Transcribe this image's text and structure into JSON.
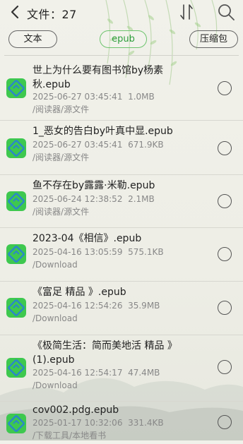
{
  "header": {
    "title": "文件：27"
  },
  "tabs": [
    {
      "label": "文本"
    },
    {
      "label": "epub"
    },
    {
      "label": "压缩包"
    }
  ],
  "files": [
    {
      "name": "世上为什么要有图书馆by杨素秋.epub",
      "date": "2025-06-27 03:45:41",
      "size": "1.0MB",
      "path": "/阅读器/源文件"
    },
    {
      "name": "1_恶女的告白by叶真中显.epub",
      "date": "2025-06-27 03:45:41",
      "size": "671.9KB",
      "path": "/阅读器/源文件"
    },
    {
      "name": "鱼不存在by露露·米勒.epub",
      "date": "2025-06-24 12:38:52",
      "size": "2.1MB",
      "path": "/阅读器/源文件"
    },
    {
      "name": "2023-04《相信》.epub",
      "date": "2025-04-16 13:05:59",
      "size": "575.1KB",
      "path": "/Download"
    },
    {
      "name": "《富足 精品 》.epub",
      "date": "2025-04-16 12:54:26",
      "size": "35.9MB",
      "path": "/Download"
    },
    {
      "name": "《极简生活：简而美地活 精品 》(1).epub",
      "date": "2025-04-16 12:54:17",
      "size": "47.4MB",
      "path": "/Download"
    },
    {
      "name": "cov002.pdg.epub",
      "date": "2025-01-17 10:32:06",
      "size": "331.4KB",
      "path": "/下载工具/本地看书"
    }
  ],
  "colors": {
    "accent": "#2e9e3c",
    "file_icon": "#3ec84f",
    "icon_inner": "#2b86c9"
  }
}
